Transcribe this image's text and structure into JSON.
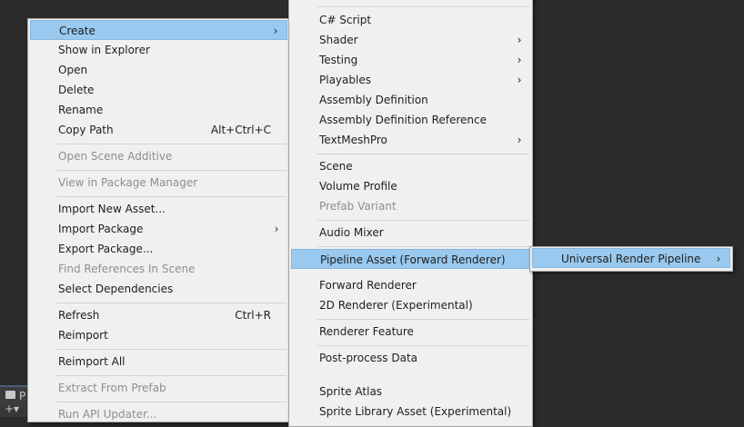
{
  "main_menu": {
    "items": [
      {
        "label": "Create",
        "arrow": "›"
      },
      {
        "label": "Show in Explorer"
      },
      {
        "label": "Open"
      },
      {
        "label": "Delete"
      },
      {
        "label": "Rename"
      },
      {
        "label": "Copy Path",
        "shortcut": "Alt+Ctrl+C"
      },
      {
        "label": "Open Scene Additive"
      },
      {
        "label": "View in Package Manager"
      },
      {
        "label": "Import New Asset..."
      },
      {
        "label": "Import Package",
        "arrow": "›"
      },
      {
        "label": "Export Package..."
      },
      {
        "label": "Find References In Scene"
      },
      {
        "label": "Select Dependencies"
      },
      {
        "label": "Refresh",
        "shortcut": "Ctrl+R"
      },
      {
        "label": "Reimport"
      },
      {
        "label": "Reimport All"
      },
      {
        "label": "Extract From Prefab"
      },
      {
        "label": "Run API Updater..."
      }
    ]
  },
  "create_menu": {
    "items": [
      {
        "label": "C# Script"
      },
      {
        "label": "Shader",
        "arrow": "›"
      },
      {
        "label": "Testing",
        "arrow": "›"
      },
      {
        "label": "Playables",
        "arrow": "›"
      },
      {
        "label": "Assembly Definition"
      },
      {
        "label": "Assembly Definition Reference"
      },
      {
        "label": "TextMeshPro",
        "arrow": "›"
      },
      {
        "label": "Scene"
      },
      {
        "label": "Volume Profile"
      },
      {
        "label": "Prefab Variant"
      },
      {
        "label": "Audio Mixer"
      },
      {
        "label": "Pipeline Asset (Forward Renderer)"
      },
      {
        "label": "Forward Renderer"
      },
      {
        "label": "2D Renderer (Experimental)"
      },
      {
        "label": "Renderer Feature"
      },
      {
        "label": "Post-process Data"
      },
      {
        "label": "Sprite Atlas"
      },
      {
        "label": "Sprite Library Asset (Experimental)"
      }
    ]
  },
  "rendering_menu": {
    "items": [
      {
        "label": "Universal Render Pipeline",
        "arrow": "›"
      }
    ]
  },
  "project_panel": {
    "tab_label": "P",
    "add_label": "+▾"
  }
}
